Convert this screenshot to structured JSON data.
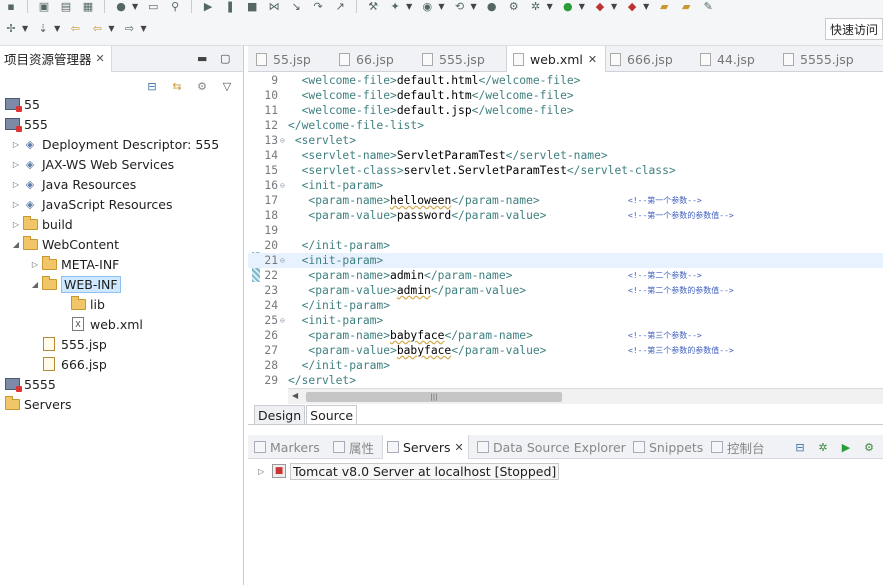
{
  "toolbar": {
    "quick_access_label": "快速访问"
  },
  "explorer": {
    "tab_label": "项目资源管理器",
    "items": [
      {
        "label": "55",
        "icon": "project-icon",
        "arrow": "",
        "indent": 0
      },
      {
        "label": "555",
        "icon": "project-icon",
        "arrow": "",
        "indent": 0
      },
      {
        "label": "Deployment Descriptor: 555",
        "icon": "descriptor-icon",
        "arrow": "▷",
        "indent": 1
      },
      {
        "label": "JAX-WS Web Services",
        "icon": "webservice-icon",
        "arrow": "▷",
        "indent": 1
      },
      {
        "label": "Java Resources",
        "icon": "java-resources-icon",
        "arrow": "▷",
        "indent": 1
      },
      {
        "label": "JavaScript Resources",
        "icon": "javascript-resources-icon",
        "arrow": "▷",
        "indent": 1
      },
      {
        "label": "build",
        "icon": "folder-icon",
        "arrow": "▷",
        "indent": 1
      },
      {
        "label": "WebContent",
        "icon": "folder-icon",
        "arrow": "◢",
        "indent": 1
      },
      {
        "label": "META-INF",
        "icon": "folder-icon",
        "arrow": "▷",
        "indent": 2
      },
      {
        "label": "WEB-INF",
        "icon": "folder-icon",
        "arrow": "◢",
        "indent": 2,
        "selected": true
      },
      {
        "label": "lib",
        "icon": "folder-icon",
        "arrow": "",
        "indent": 3
      },
      {
        "label": "web.xml",
        "icon": "xml-file-icon",
        "arrow": "",
        "indent": 3
      },
      {
        "label": "555.jsp",
        "icon": "jsp-file-icon",
        "arrow": "",
        "indent": 2
      },
      {
        "label": "666.jsp",
        "icon": "jsp-file-icon",
        "arrow": "",
        "indent": 2
      },
      {
        "label": "5555",
        "icon": "project-icon",
        "arrow": "",
        "indent": 0
      },
      {
        "label": "Servers",
        "icon": "folder-icon",
        "arrow": "",
        "indent": 0
      }
    ]
  },
  "editor": {
    "tabs": [
      {
        "label": "55.jsp",
        "active": false
      },
      {
        "label": "66.jsp",
        "active": false
      },
      {
        "label": "555.jsp",
        "active": false
      },
      {
        "label": "web.xml",
        "active": true
      },
      {
        "label": "666.jsp",
        "active": false
      },
      {
        "label": "44.jsp",
        "active": false
      },
      {
        "label": "5555.jsp",
        "active": false
      }
    ],
    "lines": [
      {
        "n": "9",
        "fold": false,
        "indent": "  ",
        "t1": "<welcome-file>",
        "v": "default.html",
        "t2": "</welcome-file>",
        "c": ""
      },
      {
        "n": "10",
        "fold": false,
        "indent": "  ",
        "t1": "<welcome-file>",
        "v": "default.htm",
        "t2": "</welcome-file>",
        "c": ""
      },
      {
        "n": "11",
        "fold": false,
        "indent": "  ",
        "t1": "<welcome-file>",
        "v": "default.jsp",
        "t2": "</welcome-file>",
        "c": ""
      },
      {
        "n": "12",
        "fold": false,
        "indent": "",
        "t1": "</welcome-file-list>",
        "v": "",
        "t2": "",
        "c": ""
      },
      {
        "n": "13",
        "fold": true,
        "indent": " ",
        "t1": "<servlet>",
        "v": "",
        "t2": "",
        "c": ""
      },
      {
        "n": "14",
        "fold": false,
        "indent": "  ",
        "t1": "<servlet-name>",
        "v": "ServletParamTest",
        "t2": "</servlet-name>",
        "c": ""
      },
      {
        "n": "15",
        "fold": false,
        "indent": "  ",
        "t1": "<servlet-class>",
        "v": "servlet.ServletParamTest",
        "t2": "</servlet-class>",
        "c": ""
      },
      {
        "n": "16",
        "fold": true,
        "indent": "  ",
        "t1": "<init-param>",
        "v": "",
        "t2": "",
        "c": ""
      },
      {
        "n": "17",
        "fold": false,
        "indent": "   ",
        "t1": "<param-name>",
        "v": "helloween",
        "t2": "</param-name>",
        "c": "<!--第一个参数-->",
        "wavy": true
      },
      {
        "n": "18",
        "fold": false,
        "indent": "   ",
        "t1": "<param-value>",
        "v": "password",
        "t2": "</param-value>",
        "c": "<!--第一个参数的参数值-->"
      },
      {
        "n": "19",
        "fold": false,
        "indent": "",
        "t1": "",
        "v": "",
        "t2": "",
        "c": ""
      },
      {
        "n": "20",
        "fold": false,
        "indent": "  ",
        "t1": "</init-param>",
        "v": "",
        "t2": "",
        "c": ""
      },
      {
        "n": "21",
        "fold": true,
        "indent": "  ",
        "t1": "<init-param>",
        "v": "",
        "t2": "",
        "c": "",
        "hl": true
      },
      {
        "n": "22",
        "fold": false,
        "indent": "   ",
        "t1": "<param-name>",
        "v": "admin",
        "t2": "</param-name>",
        "c": "<!--第二个参数-->"
      },
      {
        "n": "23",
        "fold": false,
        "indent": "   ",
        "t1": "<param-value>",
        "v": "admin",
        "t2": "</param-value>",
        "c": "<!--第二个参数的参数值-->",
        "wavy": true
      },
      {
        "n": "24",
        "fold": false,
        "indent": "  ",
        "t1": "</init-param>",
        "v": "",
        "t2": "",
        "c": ""
      },
      {
        "n": "25",
        "fold": true,
        "indent": "  ",
        "t1": "<init-param>",
        "v": "",
        "t2": "",
        "c": ""
      },
      {
        "n": "26",
        "fold": false,
        "indent": "   ",
        "t1": "<param-name>",
        "v": "babyface",
        "t2": "</param-name>",
        "c": "<!--第三个参数-->",
        "wavy": true
      },
      {
        "n": "27",
        "fold": false,
        "indent": "   ",
        "t1": "<param-value>",
        "v": "babyface",
        "t2": "</param-value>",
        "c": "<!--第三个参数的参数值-->",
        "wavy": true
      },
      {
        "n": "28",
        "fold": false,
        "indent": "  ",
        "t1": "</init-param>",
        "v": "",
        "t2": "",
        "c": ""
      },
      {
        "n": "29",
        "fold": false,
        "indent": "",
        "t1": "</servlet>",
        "v": "",
        "t2": "",
        "c": ""
      }
    ],
    "bottom_tabs": {
      "design": "Design",
      "source": "Source"
    }
  },
  "bottom_panel": {
    "tabs": [
      {
        "label": "Markers",
        "active": false
      },
      {
        "label": "属性",
        "active": false
      },
      {
        "label": "Servers",
        "active": true
      },
      {
        "label": "Data Source Explorer",
        "active": false
      },
      {
        "label": "Snippets",
        "active": false
      },
      {
        "label": "控制台",
        "active": false
      }
    ],
    "server_label": "Tomcat v8.0 Server at localhost  [Stopped]"
  }
}
